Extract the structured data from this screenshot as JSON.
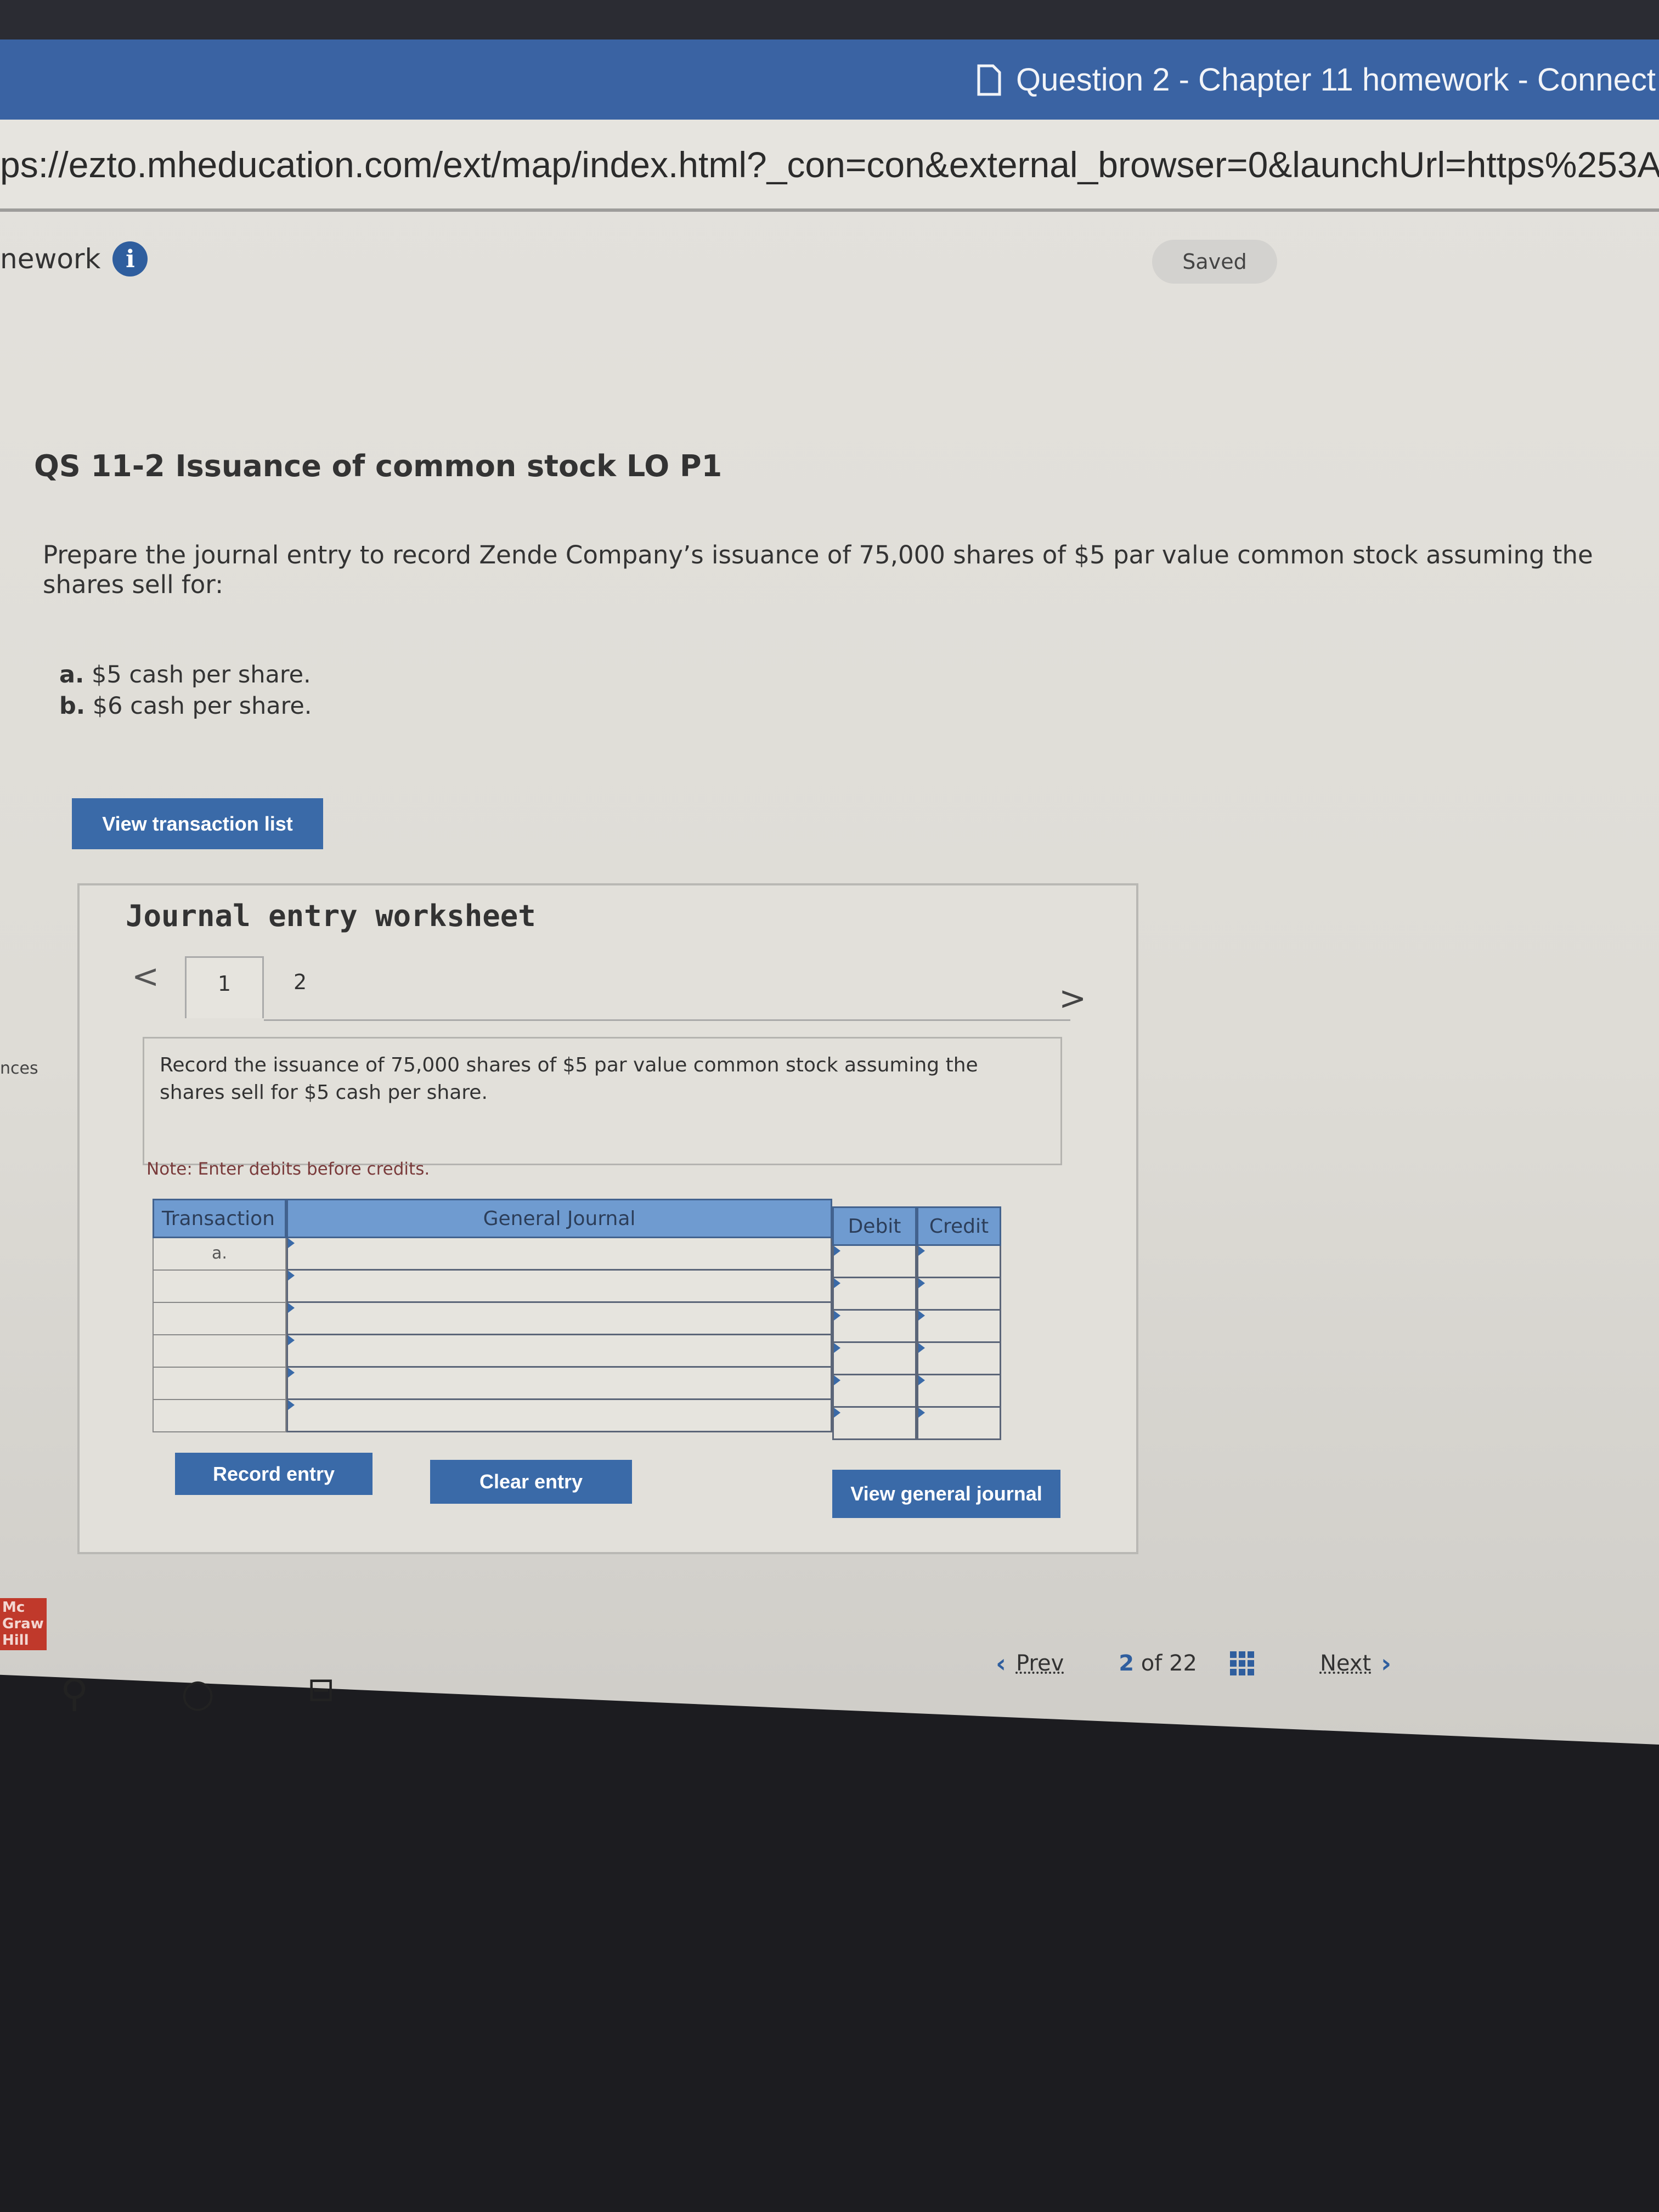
{
  "browser": {
    "window_title": "Question 2 - Chapter 11 homework - Connect",
    "url": "ps://ezto.mheducation.com/ext/map/index.html?_con=con&external_browser=0&launchUrl=https%253A%"
  },
  "header": {
    "assignment_fragment": "nework",
    "status": "Saved"
  },
  "question": {
    "title": "QS 11-2 Issuance of common stock LO P1",
    "prompt": "Prepare the journal entry to record Zende Company’s issuance of 75,000 shares of $5 par value common stock assuming the shares sell for:",
    "parts": [
      {
        "label": "a.",
        "text": "$5 cash per share."
      },
      {
        "label": "b.",
        "text": "$6 cash per share."
      }
    ]
  },
  "view_transaction_list": "View transaction list",
  "worksheet": {
    "heading": "Journal entry worksheet",
    "tabs": [
      "1",
      "2"
    ],
    "active_tab": "1",
    "description": "Record the issuance of 75,000 shares of $5 par value common stock assuming the shares sell for $5 cash per share.",
    "note": "Note: Enter debits before credits.",
    "columns": [
      "Transaction",
      "General Journal",
      "Debit",
      "Credit"
    ],
    "rows": [
      {
        "transaction": "a."
      },
      {
        "transaction": ""
      },
      {
        "transaction": ""
      },
      {
        "transaction": ""
      },
      {
        "transaction": ""
      },
      {
        "transaction": ""
      }
    ],
    "record_entry": "Record entry",
    "clear_entry": "Clear entry",
    "view_general_journal": "View general journal"
  },
  "sidebar_fragment": "nces",
  "logo": "Mc Graw Hill",
  "pager": {
    "prev": "Prev",
    "current": "2",
    "of_label": "of 22",
    "next": "Next"
  },
  "colors": {
    "brand_blue": "#3a63a3",
    "button": "#3a6aa8",
    "table_header": "#6f9bd0",
    "logo_red": "#c0392b"
  }
}
